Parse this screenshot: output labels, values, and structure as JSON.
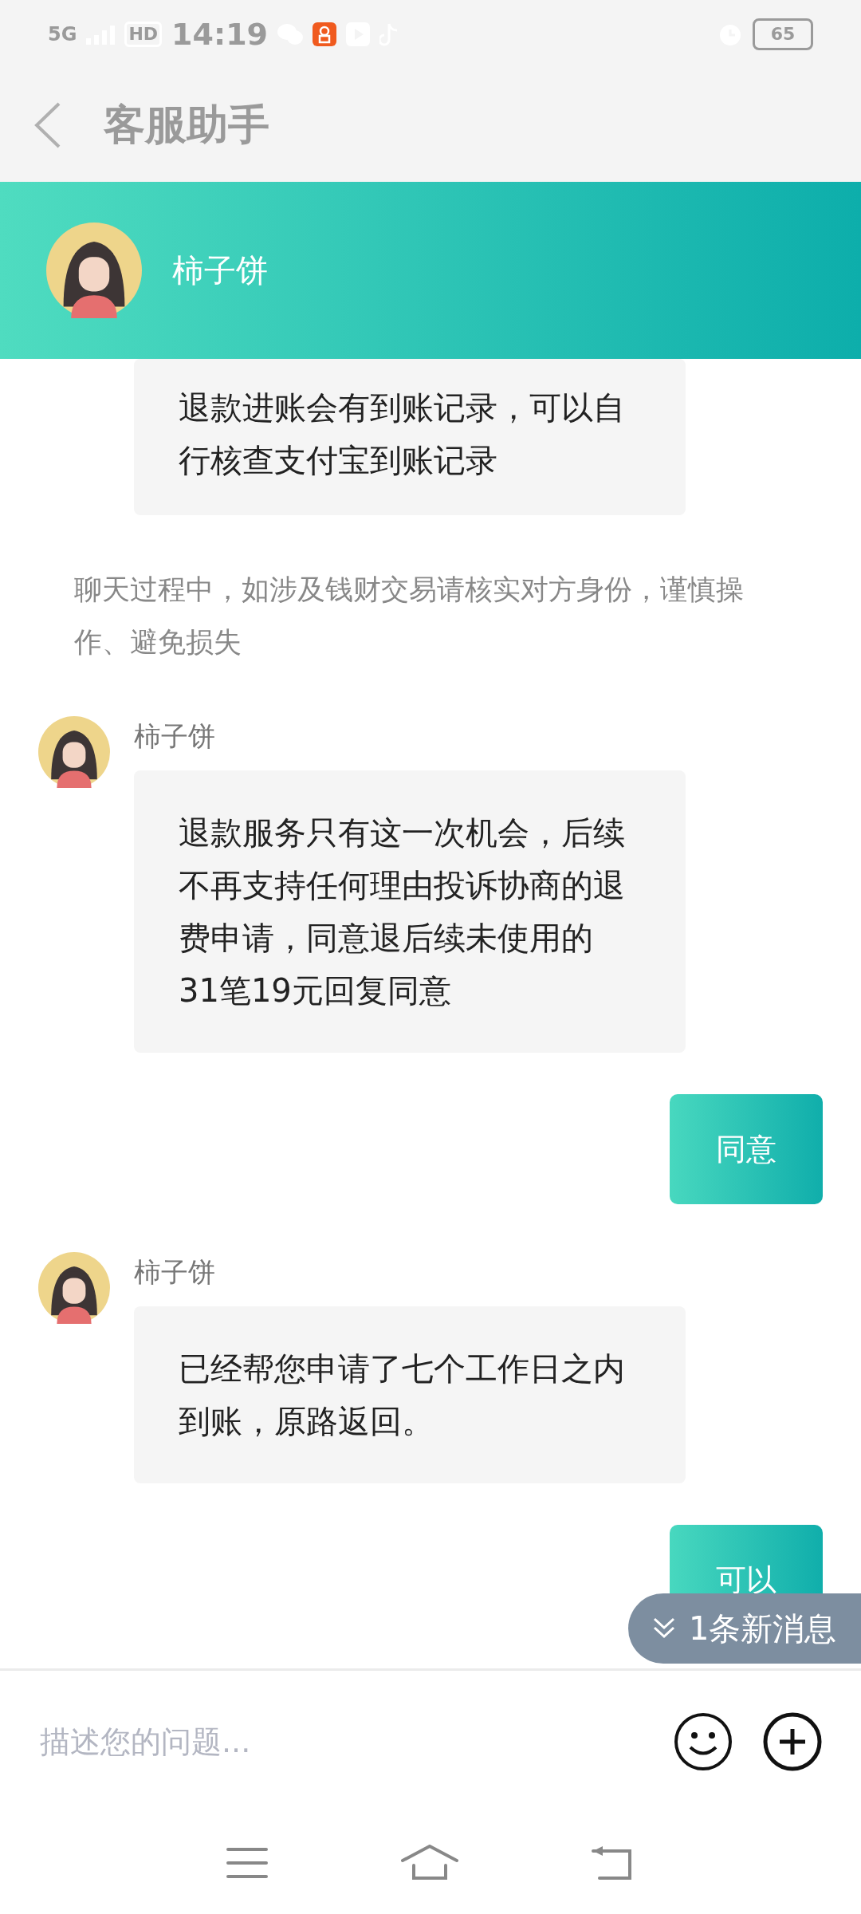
{
  "status_bar": {
    "network": "5G",
    "hd": "HD",
    "time": "14:19",
    "battery": "65"
  },
  "header": {
    "title": "客服助手"
  },
  "contact": {
    "name": "柿子饼"
  },
  "messages": [
    {
      "kind": "incoming",
      "text": "退款进账会有到账记录，可以自行核查支付宝到账记录"
    },
    {
      "kind": "notice",
      "text": "聊天过程中，如涉及钱财交易请核实对方身份，谨慎操作、避免损失"
    },
    {
      "kind": "incoming",
      "sender": "柿子饼",
      "text": "退款服务只有这一次机会，后续不再支持任何理由投诉协商的退费申请，同意退后续未使用的31笔19元回复同意"
    },
    {
      "kind": "outgoing",
      "text": "同意"
    },
    {
      "kind": "incoming",
      "sender": "柿子饼",
      "text": "已经帮您申请了七个工作日之内到账，原路返回。"
    },
    {
      "kind": "outgoing",
      "text": "可以"
    }
  ],
  "new_messages": {
    "text": "1条新消息"
  },
  "input": {
    "placeholder": "描述您的问题..."
  }
}
